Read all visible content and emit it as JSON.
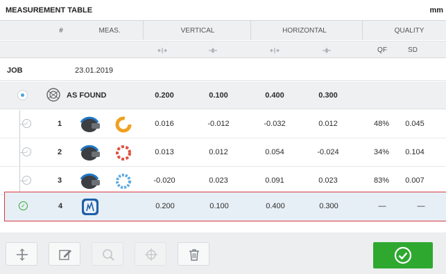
{
  "header": {
    "title": "MEASUREMENT TABLE",
    "unit": "mm"
  },
  "columns": {
    "number": "#",
    "meas": "MEAS.",
    "vertical": "VERTICAL",
    "horizontal": "HORIZONTAL",
    "quality": "QUALITY",
    "qf": "QF",
    "sd": "SD"
  },
  "job": {
    "label": "JOB",
    "date": "23.01.2019"
  },
  "as_found": {
    "label": "AS FOUND",
    "v1": "0.200",
    "v2": "0.100",
    "h1": "0.400",
    "h2": "0.300"
  },
  "rows": [
    {
      "num": "1",
      "v1": "0.016",
      "v2": "-0.012",
      "h1": "-0.032",
      "h2": "0.012",
      "qf": "48%",
      "sd": "0.045"
    },
    {
      "num": "2",
      "v1": "0.013",
      "v2": "0.012",
      "h1": "0.054",
      "h2": "-0.024",
      "qf": "34%",
      "sd": "0.104"
    },
    {
      "num": "3",
      "v1": "-0.020",
      "v2": "0.023",
      "h1": "0.091",
      "h2": "0.023",
      "qf": "83%",
      "sd": "0.007"
    },
    {
      "num": "4",
      "v1": "0.200",
      "v2": "0.100",
      "h1": "0.400",
      "h2": "0.300",
      "qf": "—",
      "sd": "—"
    }
  ],
  "toolbar": {
    "add_icon": "plus-icon",
    "edit_icon": "edit-icon",
    "zoom_icon": "search-icon",
    "target_icon": "crosshair-icon",
    "delete_icon": "trash-icon",
    "confirm_icon": "check-circle-icon"
  },
  "colors": {
    "accent": "#2fa82f",
    "selection_border": "#d9363e",
    "selection_bg": "#e7eff6",
    "blue": "#1f78c8",
    "orange": "#f0a020"
  }
}
